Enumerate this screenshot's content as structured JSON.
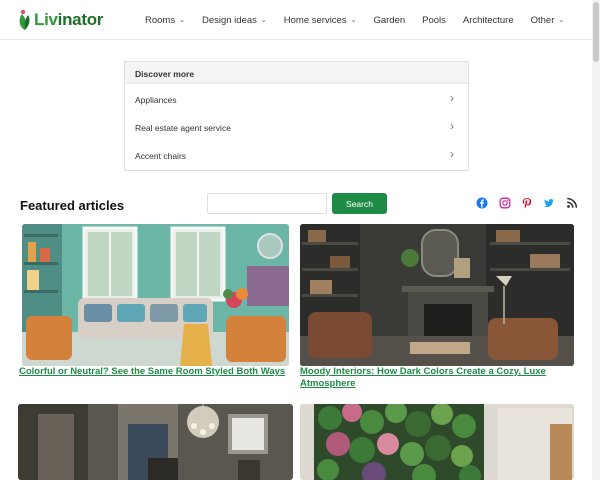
{
  "header": {
    "logo_text_a": "Liv",
    "logo_text_b": "inator",
    "nav": [
      {
        "label": "Rooms",
        "has_dropdown": true
      },
      {
        "label": "Design ideas",
        "has_dropdown": true
      },
      {
        "label": "Home services",
        "has_dropdown": true
      },
      {
        "label": "Garden",
        "has_dropdown": false
      },
      {
        "label": "Pools",
        "has_dropdown": false
      },
      {
        "label": "Architecture",
        "has_dropdown": false
      },
      {
        "label": "Other",
        "has_dropdown": true
      }
    ]
  },
  "discover": {
    "title": "Discover more",
    "items": [
      "Appliances",
      "Real estate agent service",
      "Accent chairs"
    ]
  },
  "featured": {
    "title": "Featured articles",
    "search_placeholder": "",
    "search_button": "Search",
    "social_icons": [
      "facebook-icon",
      "instagram-icon",
      "pinterest-icon",
      "twitter-icon",
      "rss-icon"
    ],
    "articles": [
      {
        "title": "Colorful or Neutral? See the Same Room Styled Both Ways"
      },
      {
        "title": "Moody Interiors: How Dark Colors Create a Cozy, Luxe Atmosphere"
      },
      {
        "title": ""
      },
      {
        "title": ""
      }
    ]
  },
  "colors": {
    "accent": "#1e8c45",
    "link": "#1e8c45",
    "facebook": "#1877f2",
    "instagram": "#d6249f",
    "pinterest": "#e60023",
    "twitter": "#1da1f2",
    "rss": "#333333"
  }
}
